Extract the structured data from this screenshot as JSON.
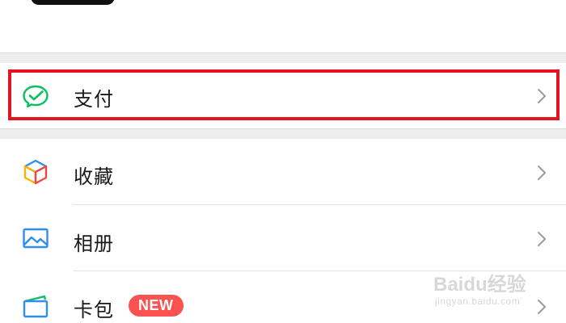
{
  "menu": {
    "items": [
      {
        "id": "pay",
        "label": "支付",
        "icon": "wechat-pay-icon",
        "highlighted": true
      },
      {
        "id": "favorites",
        "label": "收藏",
        "icon": "favorites-cube-icon"
      },
      {
        "id": "album",
        "label": "相册",
        "icon": "album-picture-icon"
      },
      {
        "id": "cards",
        "label": "卡包",
        "icon": "card-wallet-icon",
        "badge": "NEW"
      }
    ]
  },
  "colors": {
    "accent_green": "#07c160",
    "highlight_red": "#e3141f",
    "badge_red": "#fa5151"
  },
  "watermark": {
    "logo": "Baidu经验",
    "sub": "jingyan.baidu.com"
  }
}
